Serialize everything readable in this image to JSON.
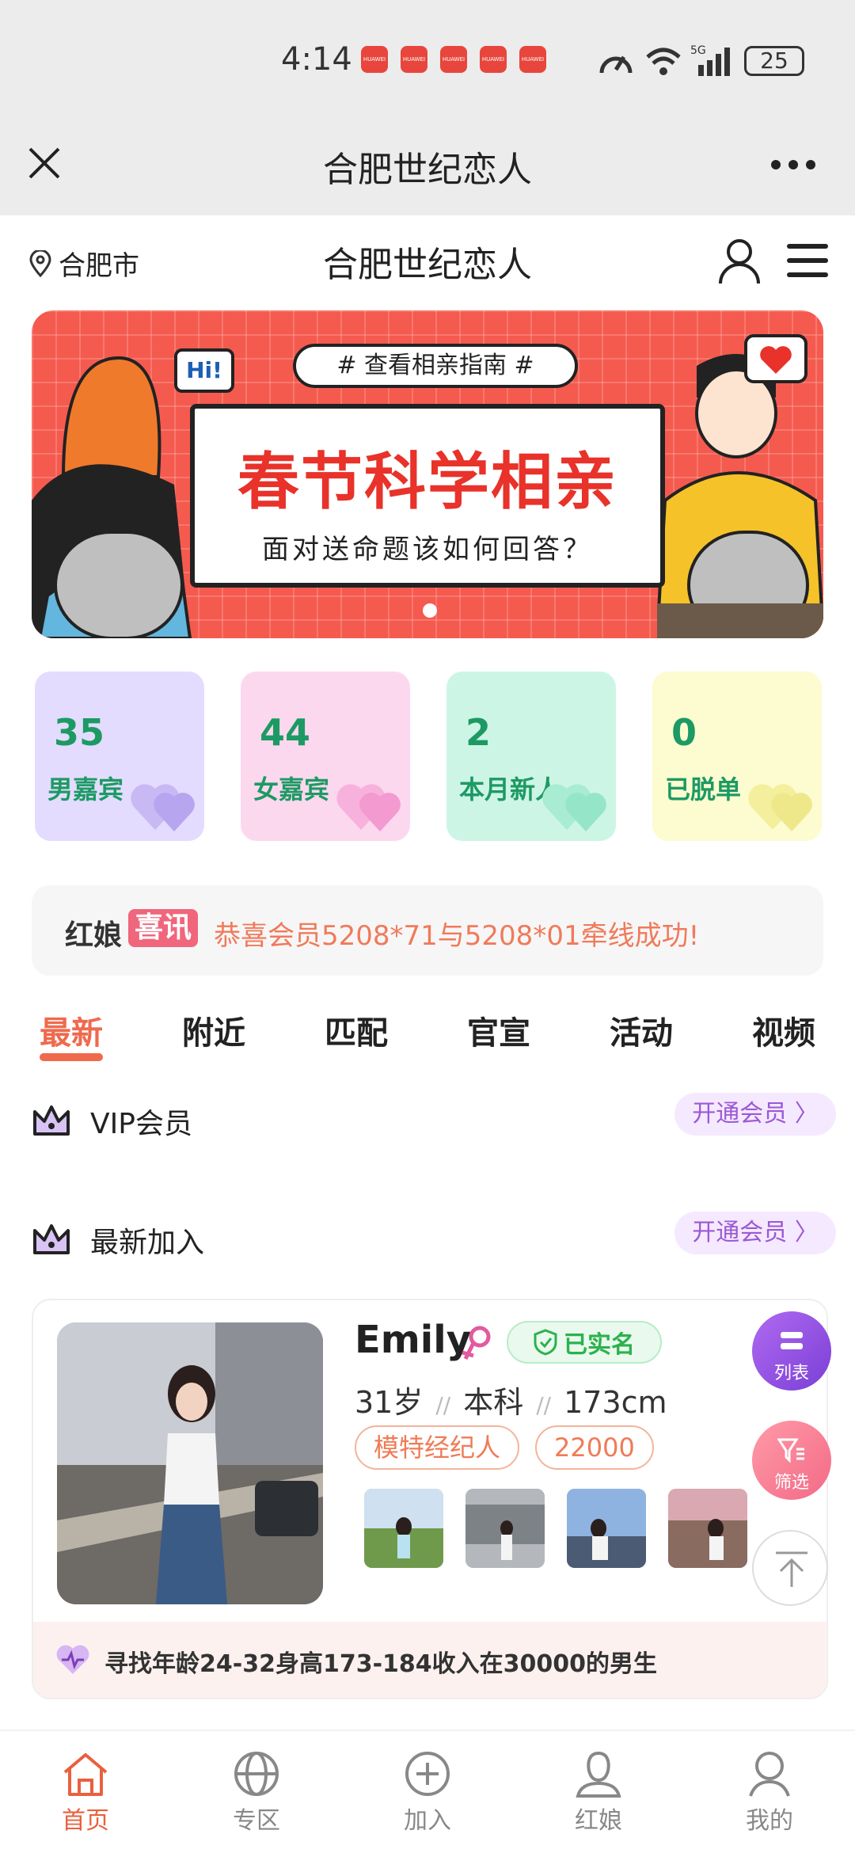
{
  "status_bar": {
    "time": "4:14",
    "battery": "25"
  },
  "window": {
    "title": "合肥世纪恋人"
  },
  "header": {
    "location": "合肥市",
    "title": "合肥世纪恋人"
  },
  "banner": {
    "tag": "# 查看相亲指南 #",
    "hi": "Hi!",
    "title": "春节科学相亲",
    "subtitle": "面对送命题该如何回答？"
  },
  "stats": [
    {
      "value": "35",
      "label": "男嘉宾",
      "bg": "#e3dcff",
      "color": "#1d9a64"
    },
    {
      "value": "44",
      "label": "女嘉宾",
      "bg": "#fcd8ef",
      "color": "#1d9a64"
    },
    {
      "value": "2",
      "label": "本月新人",
      "bg": "#cdf5e6",
      "color": "#1d9a64"
    },
    {
      "value": "0",
      "label": "已脱单",
      "bg": "#fdfbd0",
      "color": "#1d9a64"
    }
  ],
  "news": {
    "label_a": "红娘",
    "label_b": "喜讯",
    "message": "恭喜会员5208*71与5208*01牵线成功!"
  },
  "tabs": [
    "最新",
    "附近",
    "匹配",
    "官宣",
    "活动",
    "视频"
  ],
  "sections": {
    "vip": {
      "title": "VIP会员",
      "button": "开通会员 〉"
    },
    "newest": {
      "title": "最新加入",
      "button": "开通会员 〉"
    }
  },
  "profile": {
    "name": "Emily",
    "verified": "已实名",
    "age": "31岁",
    "education": "本科",
    "height": "173cm",
    "tags": [
      "模特经纪人",
      "22000"
    ],
    "seeking": "寻找年龄24-32身高173-184收入在30000的男生"
  },
  "floating": {
    "list": "列表",
    "filter": "筛选"
  },
  "bottom_nav": [
    {
      "label": "首页",
      "icon": "home-icon"
    },
    {
      "label": "专区",
      "icon": "zone-icon"
    },
    {
      "label": "加入",
      "icon": "plus-circle-icon"
    },
    {
      "label": "红娘",
      "icon": "matchmaker-icon"
    },
    {
      "label": "我的",
      "icon": "profile-icon"
    }
  ],
  "colors": {
    "accent": "#ef6a4d",
    "vip": "#9b59d6",
    "green": "#2bb24c"
  }
}
